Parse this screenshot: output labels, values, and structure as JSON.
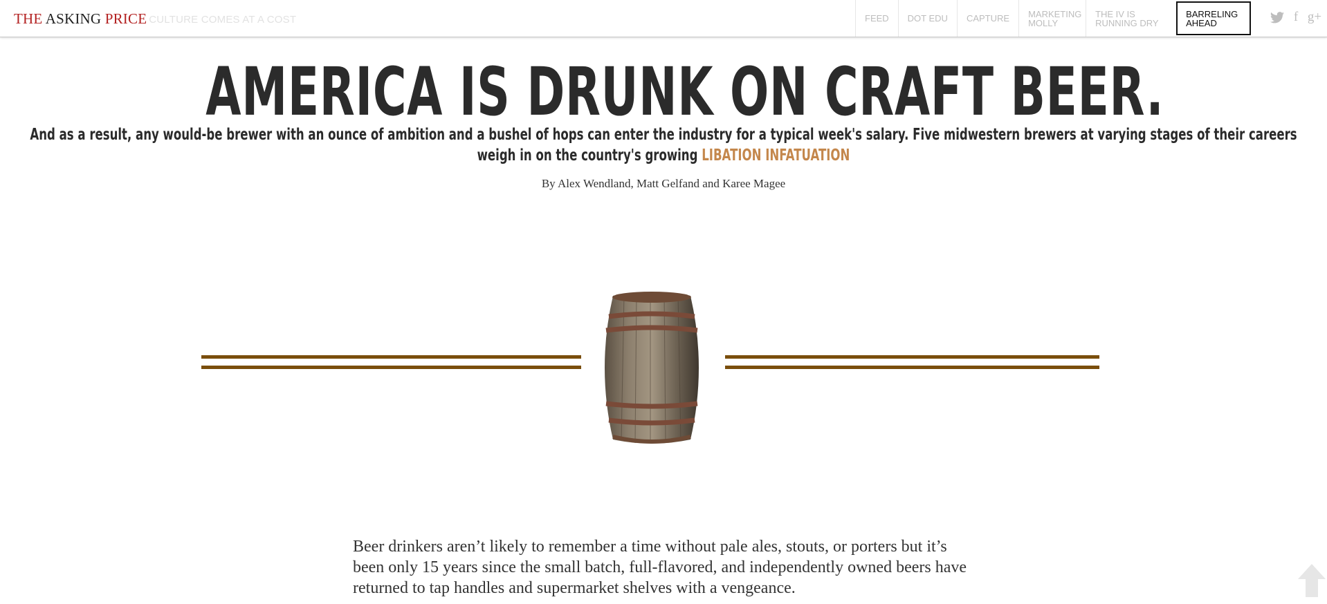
{
  "brand": {
    "word1": "THE",
    "word2": "ASKING",
    "word3": "PRICE",
    "tagline": "CULTURE COMES AT A COST"
  },
  "nav": [
    {
      "label": "FEED"
    },
    {
      "label": "DOT EDU"
    },
    {
      "label": "CAPTURE"
    },
    {
      "label": "MARKETING MOLLY"
    },
    {
      "label": "THE IV IS RUNNING DRY"
    },
    {
      "label": "BARRELING AHEAD",
      "active": true
    }
  ],
  "social": {
    "twitter": "twitter-icon",
    "facebook": "facebook-icon",
    "google_plus": "google-plus-icon",
    "facebook_glyph": "f",
    "google_glyph": "g+"
  },
  "article": {
    "headline": "AMERICA IS DRUNK ON CRAFT BEER.",
    "subhead_text": "And as a result, any would-be brewer with an ounce of ambition and a bushel of hops can enter the industry for a typical week's salary. Five midwestern brewers at varying stages of their careers weigh in on the country's growing ",
    "subhead_accent": "LIBATION INFATUATION",
    "byline": "By Alex Wendland, Matt Gelfand and Karee Magee",
    "body": "Beer drinkers aren’t likely to remember a time without pale ales, stouts, or porters but it’s been only 15 years since the small batch, full-flavored, and independently owned beers have returned to tap handles and supermarket shelves with a vengeance."
  },
  "colors": {
    "brand_red": "#b32121",
    "accent": "#c4874c",
    "rule": "#7a4e0c"
  }
}
